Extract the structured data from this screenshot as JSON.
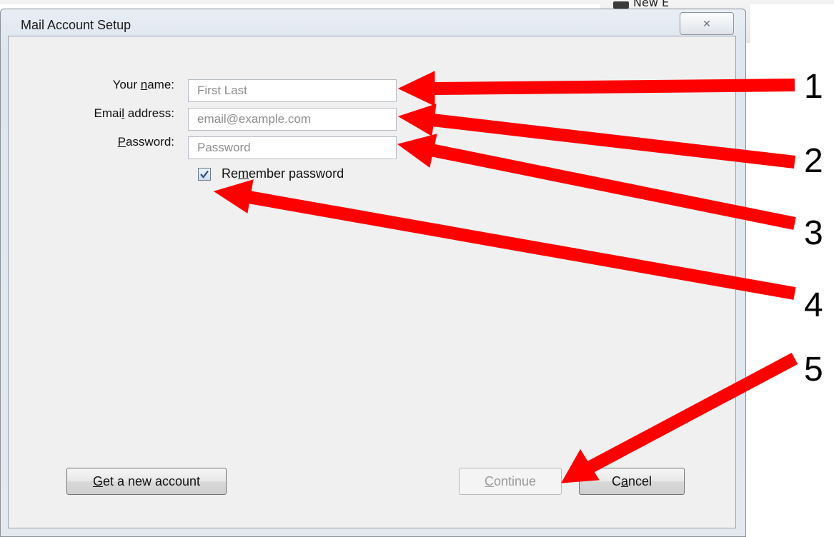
{
  "background_app": {
    "partial_text": "New E"
  },
  "dialog": {
    "title": "Mail Account Setup",
    "close_glyph": "✕"
  },
  "form": {
    "name": {
      "label_pre": "Your ",
      "label_underlined": "n",
      "label_post": "ame:",
      "placeholder": "First Last",
      "value": ""
    },
    "email": {
      "label_pre": "Emai",
      "label_underlined": "l",
      "label_post": " address:",
      "placeholder": "email@example.com",
      "value": ""
    },
    "password": {
      "label_pre": "",
      "label_underlined": "P",
      "label_post": "assword:",
      "placeholder": "Password",
      "value": ""
    },
    "remember": {
      "label_pre": "Re",
      "label_underlined": "m",
      "label_post": "ember password",
      "checked": true
    }
  },
  "buttons": {
    "new_account": {
      "pre": "",
      "underlined": "G",
      "post": "et a new account"
    },
    "continue": {
      "pre": "",
      "underlined": "C",
      "post": "ontinue",
      "disabled": true
    },
    "cancel": {
      "pre": "C",
      "underlined": "a",
      "post": "ncel"
    }
  },
  "annotations": {
    "color": "#ff0000",
    "numbers": [
      "1",
      "2",
      "3",
      "4",
      "5"
    ]
  }
}
